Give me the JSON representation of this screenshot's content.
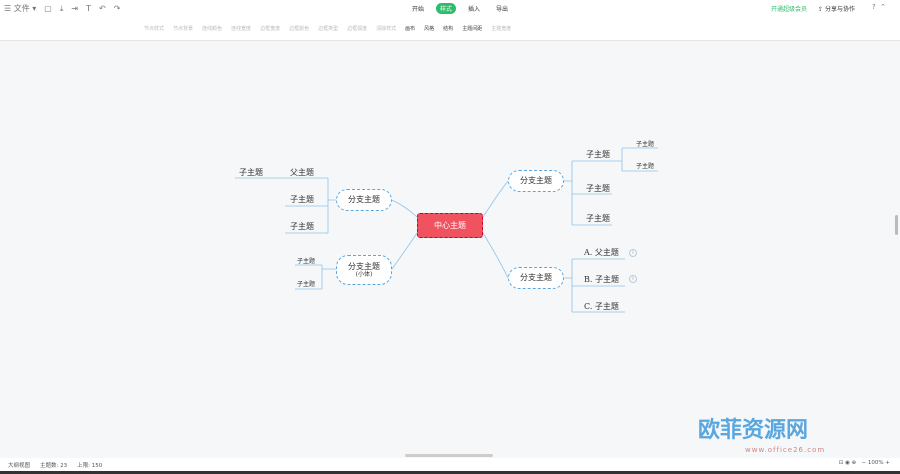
{
  "top": {
    "file": "文件",
    "tabs": [
      "开始",
      "样式",
      "插入",
      "导出"
    ],
    "active_tab": "样式",
    "vip": "开通超级会员",
    "share": "分享与协作",
    "help": "?"
  },
  "toolbar": [
    "节点样式",
    "节点背景",
    "连线颜色",
    "连线宽度",
    "边框宽度",
    "边框颜色",
    "边框类型",
    "边框弧度",
    "清除样式",
    "画布",
    "风格",
    "结构",
    "主题间距",
    "主题宽度"
  ],
  "map": {
    "center": "中心主题",
    "right_top": {
      "label": "分支主题",
      "children": [
        "子主题",
        "子主题",
        "子主题"
      ],
      "grandchildren": [
        "子主题",
        "子主题"
      ]
    },
    "right_bottom": {
      "label": "分支主题",
      "children": [
        "A. 父主题",
        "B. 子主题",
        "C. 子主题"
      ]
    },
    "left_top": {
      "label": "分支主题",
      "children": [
        "父主题",
        "子主题",
        "子主题"
      ],
      "grandchild": "子主题"
    },
    "left_bottom": {
      "label": "分支主题",
      "sublabel": "(小体)",
      "children": [
        "子主题",
        "子主题"
      ]
    }
  },
  "status": {
    "outline": "大纲视图",
    "topic_count": "主题数: 23",
    "limit": "上限: 150",
    "zoom": "100%"
  },
  "watermark": {
    "text": "欧菲资源网",
    "url": "www.office26.com"
  }
}
